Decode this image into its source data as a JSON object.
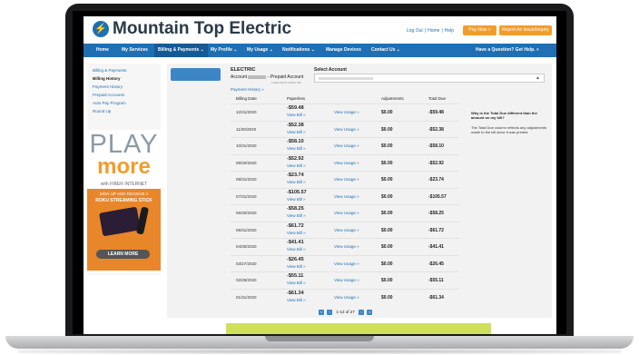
{
  "header": {
    "brand": "Mountain Top Electric",
    "logo_icon": "lightning-icon",
    "links": [
      "Log Out",
      "Home",
      "Help"
    ],
    "pay_now": "Pay Now »",
    "report": "Report An Issue/Inquiry",
    "accent": "#f39c2c",
    "primary": "#1e6fb3"
  },
  "nav": {
    "items": [
      "Home",
      "My Services",
      "Billing & Payments ⌄",
      "My Profile ⌄",
      "My Usage ⌄",
      "Notifications ⌄",
      "Manage Devices",
      "Contact Us ⌄"
    ],
    "help": "Have a Question? Get Help. »"
  },
  "sidebar": {
    "items": [
      "Billing & Payments",
      "Billing History",
      "Payment History",
      "Prepaid Accounts",
      "Auto Pay Program",
      "Round Up"
    ]
  },
  "ad": {
    "play": "PLAY",
    "more": "more",
    "fiber": "with FIBER INTERNET",
    "signup": "SIGN UP AND RECEIVE A",
    "roku": "ROKU STREAMING STICK",
    "learn": "LEARN MORE"
  },
  "account": {
    "label": "ELECTRIC",
    "account_prefix": "Account",
    "account_suffix": "- Prepaid Account",
    "address": "LAKE SAINT LOUIS MO",
    "select_label": "Select Account",
    "payment_history": "Payment History »"
  },
  "table": {
    "headers": [
      "Billing Date",
      "Paperless",
      "Adjustments",
      "Total Due"
    ],
    "view_bill": "View Bill »",
    "view_usage": "View Usage »",
    "rows": [
      {
        "date": "12/31/2020",
        "amount": "-$59.48",
        "adj": "$0.00",
        "total": "-$59.48"
      },
      {
        "date": "11/30/2020",
        "amount": "-$52.38",
        "adj": "$0.00",
        "total": "-$52.38"
      },
      {
        "date": "10/31/2020",
        "amount": "-$58.10",
        "adj": "$0.00",
        "total": "-$58.10"
      },
      {
        "date": "09/30/2020",
        "amount": "-$52.92",
        "adj": "$0.00",
        "total": "-$52.92"
      },
      {
        "date": "08/31/2020",
        "amount": "-$23.74",
        "adj": "$0.00",
        "total": "-$23.74"
      },
      {
        "date": "07/31/2020",
        "amount": "-$105.57",
        "adj": "$0.00",
        "total": "-$105.57"
      },
      {
        "date": "06/30/2020",
        "amount": "-$58.25",
        "adj": "$0.00",
        "total": "-$58.25"
      },
      {
        "date": "05/31/2020",
        "amount": "-$61.72",
        "adj": "$0.00",
        "total": "-$61.72"
      },
      {
        "date": "04/30/2020",
        "amount": "-$41.41",
        "adj": "$0.00",
        "total": "-$41.41"
      },
      {
        "date": "03/27/2020",
        "amount": "-$26.45",
        "adj": "$0.00",
        "total": "-$26.45"
      },
      {
        "date": "02/29/2020",
        "amount": "-$55.11",
        "adj": "$0.00",
        "total": "-$55.11"
      },
      {
        "date": "01/31/2020",
        "amount": "-$61.34",
        "adj": "$0.00",
        "total": "-$61.34"
      }
    ]
  },
  "note": {
    "question": "Why is the Total Due different than the amount on my bill?",
    "answer": "The Total Due column reflects any adjustments made to the bill since it was printed."
  },
  "pager": {
    "first": "«",
    "prev": "‹",
    "range": "1-12 of 27",
    "next": "›",
    "last": "»"
  }
}
